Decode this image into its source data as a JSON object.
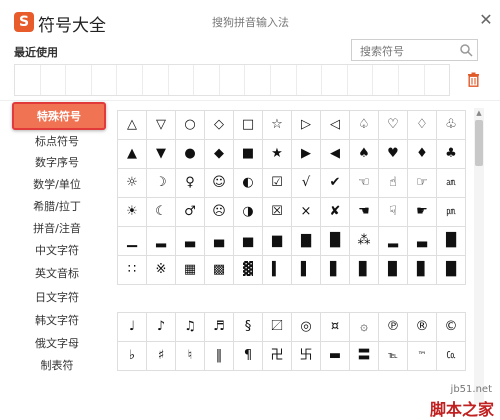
{
  "app": {
    "logo_glyph": "S",
    "title": "符号大全",
    "window_title": "搜狗拼音输入法",
    "close_glyph": "✕",
    "accent_color": "#f07453"
  },
  "recent": {
    "label": "最近使用",
    "slots": 17
  },
  "search": {
    "placeholder": "搜索符号"
  },
  "sidebar": {
    "items": [
      {
        "label": "特殊符号",
        "active": true
      },
      {
        "label": "标点符号"
      },
      {
        "label": "数字序号"
      },
      {
        "label": "数学/单位"
      },
      {
        "label": "希腊/拉丁"
      },
      {
        "label": "拼音/注音"
      },
      {
        "label": "中文字符"
      },
      {
        "label": "英文音标"
      },
      {
        "label": "日文字符"
      },
      {
        "label": "韩文字符"
      },
      {
        "label": "俄文字母"
      },
      {
        "label": "制表符"
      }
    ]
  },
  "grid1": [
    [
      "△",
      "▽",
      "○",
      "◇",
      "□",
      "☆",
      "▷",
      "◁",
      "♤",
      "♡",
      "♢",
      "♧"
    ],
    [
      "▲",
      "▼",
      "●",
      "◆",
      "■",
      "★",
      "▶",
      "◀",
      "♠",
      "♥",
      "♦",
      "♣"
    ],
    [
      "☼",
      "☽",
      "♀",
      "☺",
      "◐",
      "☑",
      "√",
      "✔",
      "☜",
      "☝",
      "☞",
      "㏂"
    ],
    [
      "☀",
      "☾",
      "♂",
      "☹",
      "◑",
      "☒",
      "×",
      "✘",
      "☚",
      "☟",
      "☛",
      "㏘"
    ],
    [
      "▁",
      "▂",
      "▃",
      "▄",
      "▅",
      "▆",
      "▇",
      "█",
      "⁂",
      "▂",
      "▃",
      "█"
    ],
    [
      "∷",
      "※",
      "▦",
      "▩",
      "▓",
      "▍",
      "▌",
      "▋",
      "▊",
      "▉",
      "▊",
      "█"
    ]
  ],
  "grid2": [
    [
      "♩",
      "♪",
      "♫",
      "♬",
      "§",
      "〼",
      "◎",
      "¤",
      "۞",
      "℗",
      "®",
      "©"
    ],
    [
      "♭",
      "♯",
      "♮",
      "‖",
      "¶",
      "卍",
      "卐",
      "▬",
      "〓",
      "℡",
      "™",
      "㏇"
    ]
  ],
  "watermark": {
    "url": "jb51.net",
    "text": "脚本之家"
  }
}
